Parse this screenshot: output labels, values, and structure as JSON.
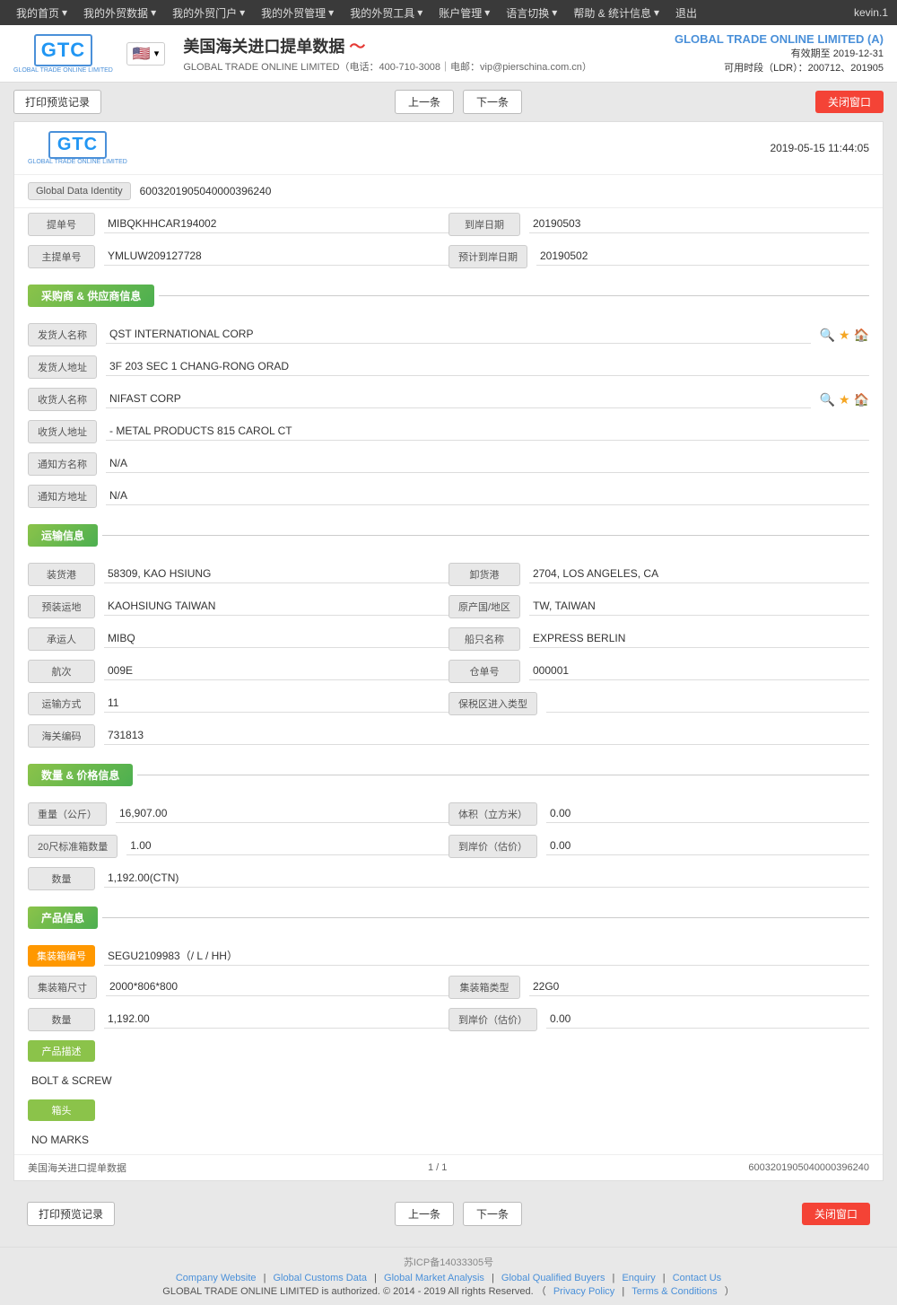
{
  "topnav": {
    "items": [
      {
        "label": "我的首页",
        "id": "home"
      },
      {
        "label": "我的外贸数据",
        "id": "trade-data"
      },
      {
        "label": "我的外贸门户",
        "id": "portal"
      },
      {
        "label": "我的外贸管理",
        "id": "management"
      },
      {
        "label": "我的外贸工具",
        "id": "tools"
      },
      {
        "label": "账户管理",
        "id": "account"
      },
      {
        "label": "语言切换",
        "id": "language"
      },
      {
        "label": "帮助 & 统计信息",
        "id": "help"
      },
      {
        "label": "退出",
        "id": "logout"
      }
    ],
    "user": "kevin.1"
  },
  "header": {
    "logo_text": "GTC",
    "logo_sub": "GLOBAL TRADE ONLINE LIMITED",
    "title": "美国海关进口提单数据",
    "subtitle": "GLOBAL TRADE ONLINE LIMITED（电话：400-710-3008｜电邮：vip@pierschina.com.cn）",
    "company": "GLOBAL TRADE ONLINE LIMITED (A)",
    "valid_until": "有效期至 2019-12-31",
    "ldr": "可用时段（LDR）：200712、201905"
  },
  "toolbar": {
    "print_label": "打印预览记录",
    "prev_label": "上一条",
    "next_label": "下一条",
    "close_label": "关闭窗口"
  },
  "card": {
    "timestamp": "2019-05-15 11:44:05",
    "gdi_label": "Global Data Identity",
    "gdi_value": "6003201905040000396240",
    "fields": {
      "bill_no_label": "提单号",
      "bill_no_value": "MIBQKHHCAR194002",
      "arrival_date_label": "到岸日期",
      "arrival_date_value": "20190503",
      "master_bill_label": "主提单号",
      "master_bill_value": "YMLUW209127728",
      "estimated_date_label": "预计到岸日期",
      "estimated_date_value": "20190502"
    },
    "supplier_section": {
      "title": "采购商 & 供应商信息",
      "shipper_name_label": "发货人名称",
      "shipper_name_value": "QST INTERNATIONAL CORP",
      "shipper_addr_label": "发货人地址",
      "shipper_addr_value": "3F 203 SEC 1 CHANG-RONG ORAD",
      "consignee_name_label": "收货人名称",
      "consignee_name_value": "NIFAST CORP",
      "consignee_addr_label": "收货人地址",
      "consignee_addr_value": "- METAL PRODUCTS 815 CAROL CT",
      "notify_name_label": "通知方名称",
      "notify_name_value": "N/A",
      "notify_addr_label": "通知方地址",
      "notify_addr_value": "N/A"
    },
    "transport_section": {
      "title": "运输信息",
      "loading_port_label": "装货港",
      "loading_port_value": "58309, KAO HSIUNG",
      "unloading_port_label": "卸货港",
      "unloading_port_value": "2704, LOS ANGELES, CA",
      "pre_carrier_label": "预装运地",
      "pre_carrier_value": "KAOHSIUNG TAIWAN",
      "origin_label": "原产国/地区",
      "origin_value": "TW, TAIWAN",
      "carrier_label": "承运人",
      "carrier_value": "MIBQ",
      "vessel_label": "船只名称",
      "vessel_value": "EXPRESS BERLIN",
      "voyage_label": "航次",
      "voyage_value": "009E",
      "hold_label": "仓单号",
      "hold_value": "000001",
      "transport_mode_label": "运输方式",
      "transport_mode_value": "11",
      "bonded_label": "保税区进入类型",
      "bonded_value": "",
      "customs_code_label": "海关编码",
      "customs_code_value": "731813"
    },
    "quantity_section": {
      "title": "数量 & 价格信息",
      "weight_label": "重量（公斤）",
      "weight_value": "16,907.00",
      "volume_label": "体积（立方米）",
      "volume_value": "0.00",
      "container20_label": "20尺标准箱数量",
      "container20_value": "1.00",
      "arrival_price_label": "到岸价（估价）",
      "arrival_price_value": "0.00",
      "quantity_label": "数量",
      "quantity_value": "1,192.00(CTN)"
    },
    "product_section": {
      "title": "产品信息",
      "container_no_label": "集装箱编号",
      "container_no_value": "SEGU2109983（/ L / HH）",
      "container_size_label": "集装箱尺寸",
      "container_size_value": "2000*806*800",
      "container_type_label": "集装箱类型",
      "container_type_value": "22G0",
      "quantity_label": "数量",
      "quantity_value": "1,192.00",
      "arrival_price_label": "到岸价（估价）",
      "arrival_price_value": "0.00",
      "product_desc_label": "产品描述",
      "product_desc_value": "BOLT & SCREW",
      "marks_label": "箱头",
      "marks_value": "NO MARKS"
    },
    "footer": {
      "left": "美国海关进口提单数据",
      "center": "1 / 1",
      "right": "6003201905040000396240"
    }
  },
  "bottom_toolbar": {
    "print_label": "打印预览记录",
    "prev_label": "上一条",
    "next_label": "下一条",
    "close_label": "关闭窗口"
  },
  "page_footer": {
    "icp": "苏ICP备14033305号",
    "links": [
      "Company Website",
      "Global Customs Data",
      "Global Market Analysis",
      "Global Qualified Buyers",
      "Enquiry",
      "Contact Us"
    ],
    "copyright": "GLOBAL TRADE ONLINE LIMITED is authorized. © 2014 - 2019 All rights Reserved.",
    "privacy": "Privacy Policy",
    "terms": "Terms & Conditions"
  }
}
